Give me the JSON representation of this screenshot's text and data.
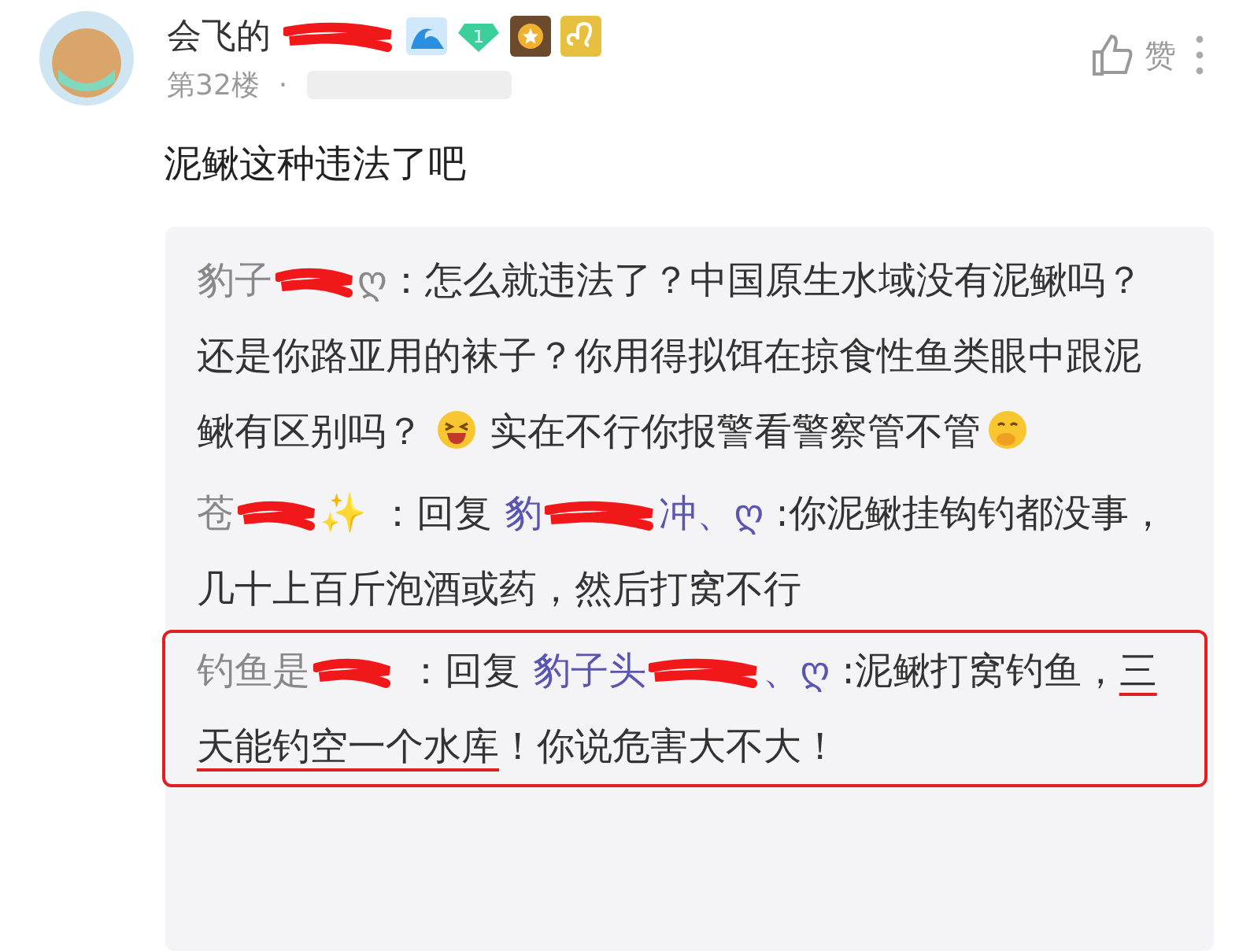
{
  "comment": {
    "author": "会飞的",
    "redacted_author": true,
    "level_badge": "1",
    "floor": "第32楼",
    "separator": "·",
    "like_label": "赞",
    "text": "泥鳅这种违法了吧"
  },
  "replies": [
    {
      "author": "豹子",
      "author_tail": "ღ",
      "redacted_author": true,
      "segments": [
        {
          "kind": "text",
          "text": "：怎么就违法了？中国原生水域没有泥鳅吗？还是你路亚用的袜子？你用得拟饵在掠食性鱼类眼中跟泥鳅有区别吗？"
        },
        {
          "kind": "emoji"
        },
        {
          "kind": "text",
          "text": "实在不行你报警看警察管不管"
        },
        {
          "kind": "emoji"
        }
      ],
      "highlighted": false
    },
    {
      "author": "苍",
      "author_tail": "✨",
      "redacted_author": true,
      "reply_prefix": "：回复",
      "target": "豹",
      "target_tail": "冲、ღ",
      "segments": [
        {
          "kind": "text",
          "text": ":你泥鳅挂钩钓都没事，几十上百斤泡酒或药，然后打窝不行"
        }
      ],
      "highlighted": false
    },
    {
      "author": "钓鱼是",
      "redacted_author": true,
      "reply_prefix": "：回复",
      "target": "豹子头",
      "target_tail": "、ღ",
      "segments": [
        {
          "kind": "text",
          "text": ":泥鳅打窝钓鱼，"
        },
        {
          "kind": "underlined",
          "text": "三天能钓空一个水库"
        },
        {
          "kind": "text",
          "text": "！你说危害大不大！"
        }
      ],
      "highlighted": true
    }
  ]
}
